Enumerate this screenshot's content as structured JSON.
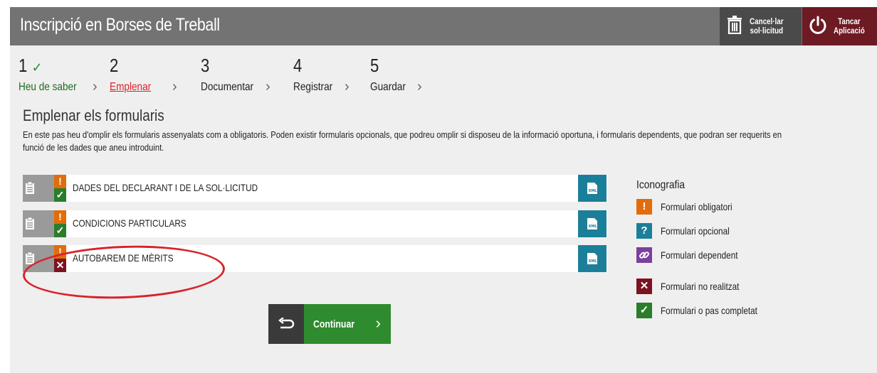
{
  "header": {
    "title": "Inscripció en Borses de Treball",
    "cancel_label": "Cancel·lar\nsol·licitud",
    "close_label": "Tancar\nAplicació"
  },
  "steps": [
    {
      "number": "1",
      "name": "Heu de saber",
      "state": "done"
    },
    {
      "number": "2",
      "name": "Emplenar",
      "state": "active"
    },
    {
      "number": "3",
      "name": "Documentar",
      "state": "pending"
    },
    {
      "number": "4",
      "name": "Registrar",
      "state": "pending"
    },
    {
      "number": "5",
      "name": "Guardar",
      "state": "pending"
    }
  ],
  "section": {
    "title": "Emplenar els formularis",
    "description_line1": "En este pas heu d'omplir els formularis assenyalats com a obligatoris. Poden existir formularis opcionals, que podreu omplir si disposeu de la informació oportuna, i formularis dependents, que podran ser requerits en",
    "description_line2": "funció de les dades que aneu introduint."
  },
  "forms": [
    {
      "name": "DADES DEL DECLARANT I DE LA SOL·LICITUD",
      "required_mark": "!",
      "status": "completed"
    },
    {
      "name": "CONDICIONS PARTICULARS",
      "required_mark": "!",
      "status": "completed"
    },
    {
      "name": "AUTOBAREM DE MÈRITS",
      "required_mark": "!",
      "status": "not_done"
    }
  ],
  "legend": {
    "title": "Iconografia",
    "items": [
      {
        "label": "Formulari obligatori",
        "symbol": "!",
        "color": "#e36c0a"
      },
      {
        "label": "Formulari opcional",
        "symbol": "?",
        "color": "#1c7f99"
      },
      {
        "label": "Formulari dependent",
        "symbol": "link-icon",
        "color": "#7b3fa0"
      },
      {
        "label": "Formulari no realitzat",
        "symbol": "✕",
        "color": "#7a1420"
      },
      {
        "label": "Formulari o pas completat",
        "symbol": "✓",
        "color": "#2a7d2a"
      }
    ]
  },
  "actions": {
    "continue_label": "Continuar"
  },
  "colors": {
    "header_bg": "#737373",
    "cancel_bg": "#4a4a4a",
    "close_bg": "#6d1a22",
    "completed": "#2a7d2a",
    "not_done": "#7a1420",
    "required": "#e36c0a",
    "xml_button": "#1c7f99",
    "active_step": "#d8232a"
  }
}
